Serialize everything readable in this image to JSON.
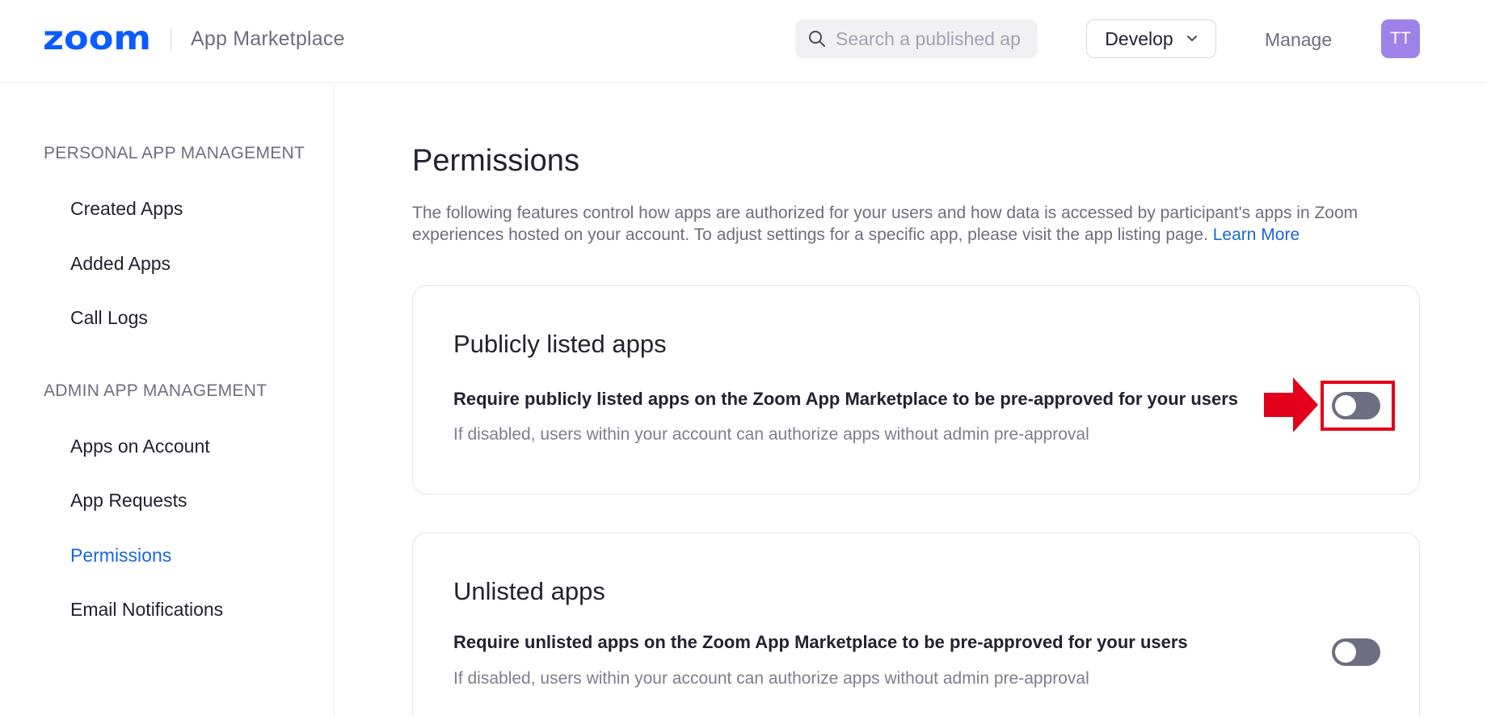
{
  "header": {
    "logo_text": "zoom",
    "brand_title": "App Marketplace",
    "search": {
      "placeholder": "Search a published app",
      "value": ""
    },
    "develop_label": "Develop",
    "manage_label": "Manage",
    "avatar_initials": "TT"
  },
  "sidebar": {
    "sections": [
      {
        "title": "PERSONAL APP MANAGEMENT",
        "items": [
          {
            "label": "Created Apps",
            "active": false
          },
          {
            "label": "Added Apps",
            "active": false
          },
          {
            "label": "Call Logs",
            "active": false
          }
        ]
      },
      {
        "title": "ADMIN APP MANAGEMENT",
        "items": [
          {
            "label": "Apps on Account",
            "active": false
          },
          {
            "label": "App Requests",
            "active": false
          },
          {
            "label": "Permissions",
            "active": true
          },
          {
            "label": "Email Notifications",
            "active": false
          }
        ]
      }
    ]
  },
  "main": {
    "title": "Permissions",
    "description": "The following features control how apps are authorized for your users and how data is accessed by participant's apps in Zoom experiences hosted on your account. To adjust settings for a specific app, please visit the app listing page.",
    "learn_more": "Learn More",
    "cards": [
      {
        "title": "Publicly listed apps",
        "setting_label": "Require publicly listed apps on the Zoom App Marketplace to be pre-approved for your users",
        "setting_description": "If disabled, users within your account can authorize apps without admin pre-approval",
        "toggle_on": false
      },
      {
        "title": "Unlisted apps",
        "setting_label": "Require unlisted apps on the Zoom App Marketplace to be pre-approved for your users",
        "setting_description": "If disabled, users within your account can authorize apps without admin pre-approval",
        "toggle_on": false
      }
    ]
  },
  "colors": {
    "brand_blue": "#0b5cff",
    "link_blue": "#1a67d6",
    "toggle_off": "#6e6e82",
    "avatar_purple": "#9e82e8",
    "annotation_red": "#e3001b"
  }
}
